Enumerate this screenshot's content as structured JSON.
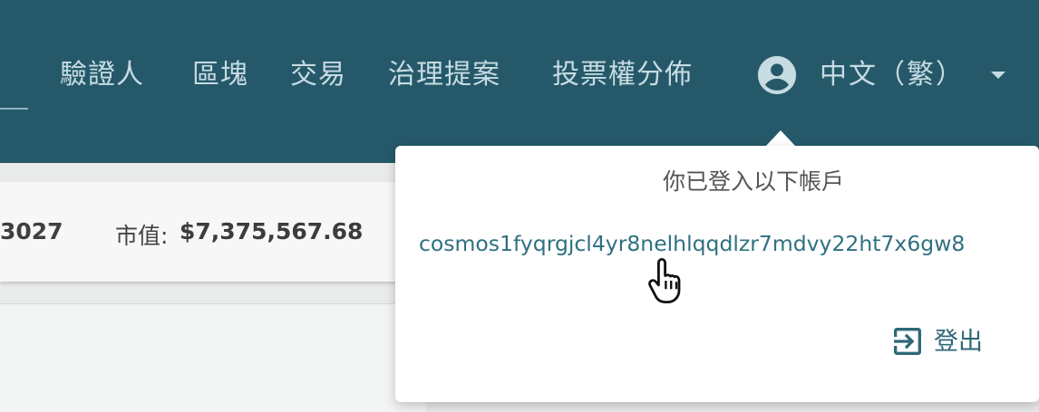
{
  "nav": {
    "items": [
      {
        "label": "驗證人"
      },
      {
        "label": "區塊"
      },
      {
        "label": "交易"
      },
      {
        "label": "治理提案"
      },
      {
        "label": "投票權分佈"
      }
    ],
    "language": "中文（繁）",
    "account_icon": "account-circle-icon",
    "caret_icon": "caret-down-icon"
  },
  "stats": {
    "partial_value": "3027",
    "market_cap_label": "市值:",
    "market_cap_value": "$7,375,567.68"
  },
  "account_popover": {
    "heading": "你已登入以下帳戶",
    "address": "cosmos1fyqrgjcl4yr8nelhlqqdlzr7mdvy22ht7x6gw8",
    "logout_label": "登出",
    "logout_icon": "logout-icon"
  },
  "colors": {
    "header_bg": "#25596a",
    "nav_text": "#c7dbe2",
    "link": "#2f7180"
  }
}
